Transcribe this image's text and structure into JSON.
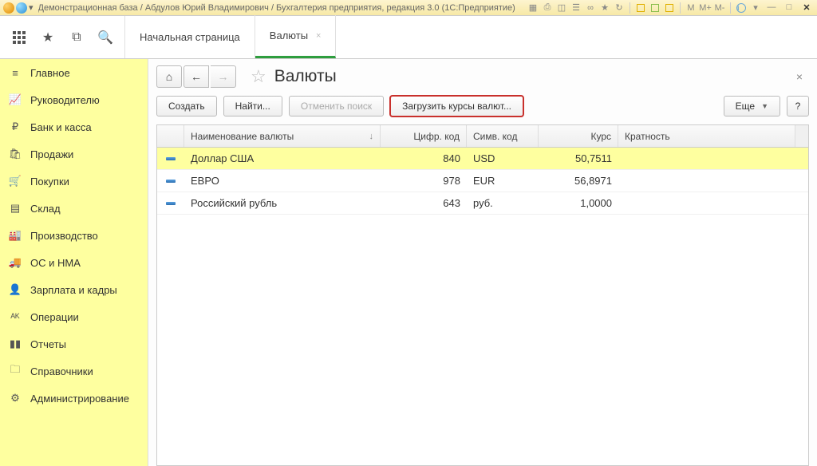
{
  "titlebar": {
    "text": "Демонстрационная база / Абдулов Юрий Владимирович / Бухгалтерия предприятия, редакция 3.0  (1С:Предприятие)",
    "m_labels": [
      "M",
      "M+",
      "M-"
    ]
  },
  "tabs": {
    "start": "Начальная страница",
    "active": "Валюты"
  },
  "sidebar": {
    "items": [
      {
        "label": "Главное"
      },
      {
        "label": "Руководителю"
      },
      {
        "label": "Банк и касса"
      },
      {
        "label": "Продажи"
      },
      {
        "label": "Покупки"
      },
      {
        "label": "Склад"
      },
      {
        "label": "Производство"
      },
      {
        "label": "ОС и НМА"
      },
      {
        "label": "Зарплата и кадры"
      },
      {
        "label": "Операции"
      },
      {
        "label": "Отчеты"
      },
      {
        "label": "Справочники"
      },
      {
        "label": "Администрирование"
      }
    ]
  },
  "page": {
    "title": "Валюты"
  },
  "toolbar": {
    "create": "Создать",
    "find": "Найти...",
    "cancel_search": "Отменить поиск",
    "load_rates": "Загрузить курсы валют...",
    "more": "Еще",
    "help": "?"
  },
  "table": {
    "headers": {
      "name": "Наименование валюты",
      "code": "Цифр. код",
      "sym": "Симв. код",
      "rate": "Курс",
      "mul": "Кратность"
    },
    "rows": [
      {
        "name": "Доллар США",
        "code": "840",
        "sym": "USD",
        "rate": "50,7511",
        "selected": true
      },
      {
        "name": "ЕВРО",
        "code": "978",
        "sym": "EUR",
        "rate": "56,8971",
        "selected": false
      },
      {
        "name": "Российский рубль",
        "code": "643",
        "sym": "руб.",
        "rate": "1,0000",
        "selected": false
      }
    ]
  }
}
